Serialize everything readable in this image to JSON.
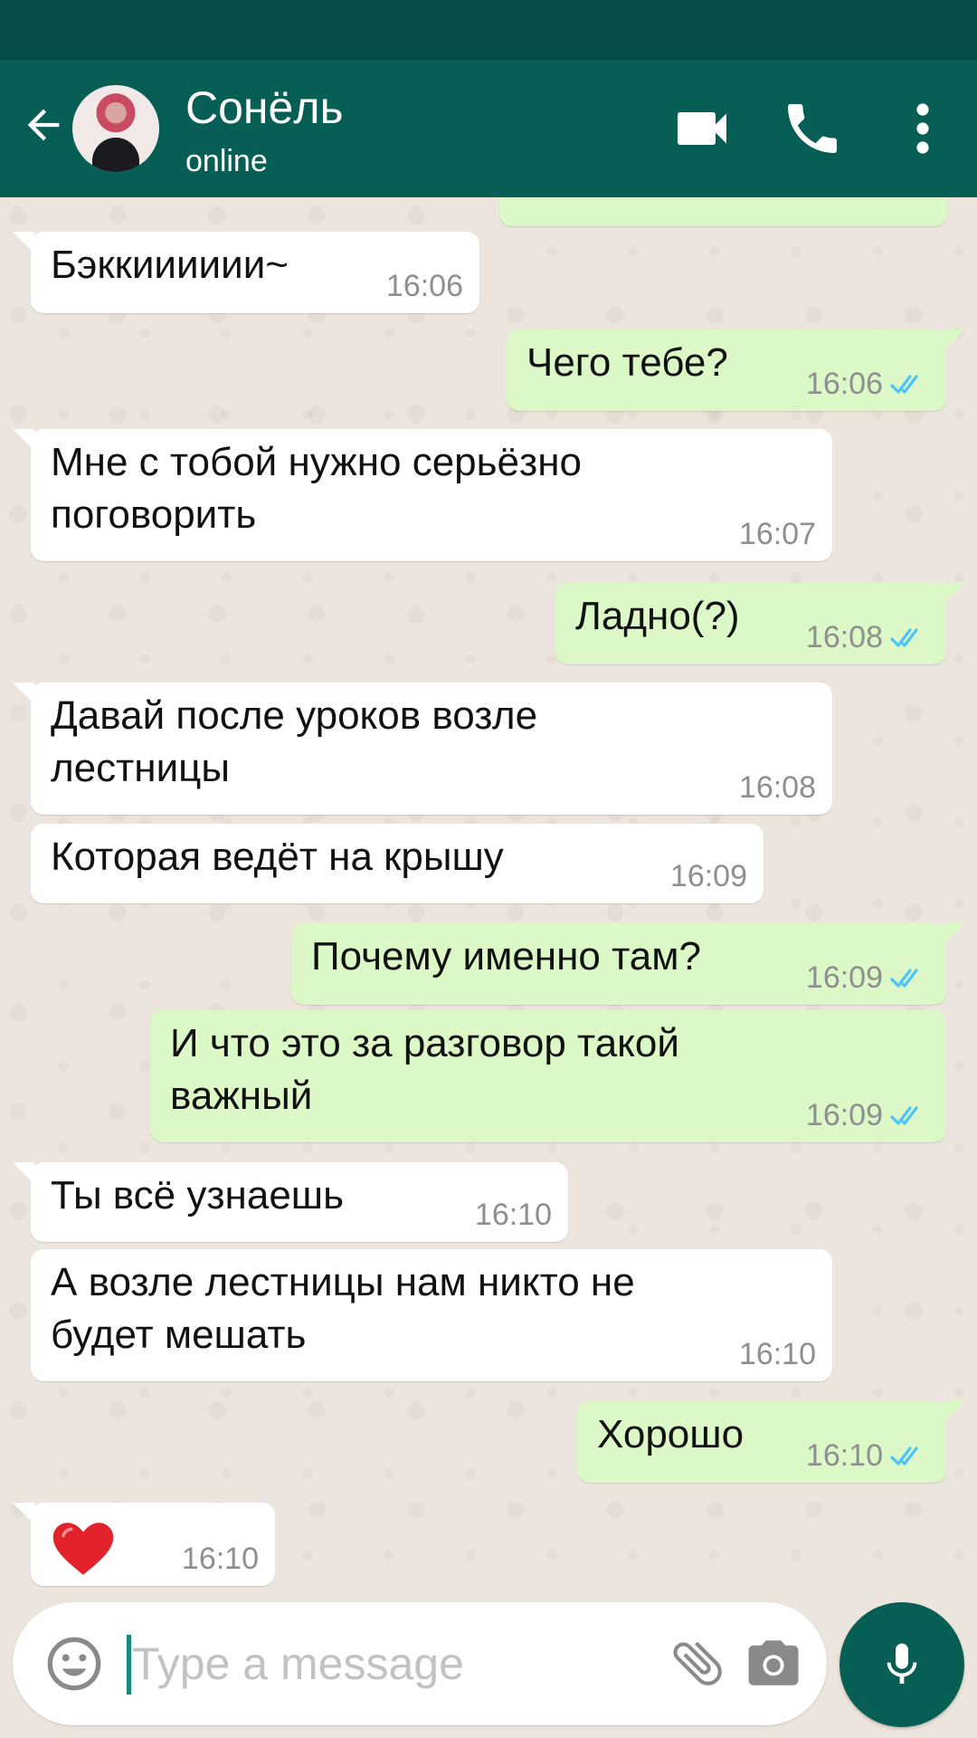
{
  "header": {
    "contact_name": "Сонёль",
    "status": "online",
    "icons": [
      "back-arrow-icon",
      "avatar",
      "video-call-icon",
      "phone-icon",
      "more-vert-icon"
    ]
  },
  "messages": [
    {
      "dir": "in",
      "text": "Бэккииииии~",
      "time": "16:06"
    },
    {
      "dir": "out",
      "text": "Чего тебе?",
      "time": "16:06",
      "status": "read"
    },
    {
      "dir": "in",
      "text": "Мне с тобой нужно серьёзно\nпоговорить",
      "time": "16:07"
    },
    {
      "dir": "out",
      "text": "Ладно(?)",
      "time": "16:08",
      "status": "read"
    },
    {
      "dir": "in",
      "text": "Давай после уроков возле\nлестницы",
      "time": "16:08"
    },
    {
      "dir": "in",
      "text": "Которая ведёт на крышу",
      "time": "16:09"
    },
    {
      "dir": "out",
      "text": "Почему именно там?",
      "time": "16:09",
      "status": "read"
    },
    {
      "dir": "out",
      "text": "И что это за разговор такой\nважный",
      "time": "16:09",
      "status": "read"
    },
    {
      "dir": "in",
      "text": "Ты всё узнаешь",
      "time": "16:10"
    },
    {
      "dir": "in",
      "text": "А возле лестницы нам никто не\nбудет мешать",
      "time": "16:10"
    },
    {
      "dir": "out",
      "text": "Хорошо",
      "time": "16:10",
      "status": "read"
    },
    {
      "dir": "in",
      "emoji": "heart-emoji-icon",
      "time": "16:10"
    }
  ],
  "composer": {
    "placeholder": "Type a message",
    "value": "",
    "icons": [
      "emoji-icon",
      "attach-icon",
      "camera-icon",
      "mic-icon"
    ]
  },
  "colors": {
    "appbar": "#075e54",
    "statusbar": "#054d44",
    "outgoing_bubble": "#dcf8c6",
    "incoming_bubble": "#ffffff",
    "read_ticks": "#4fc3f7",
    "chat_background": "#ece5dd"
  }
}
